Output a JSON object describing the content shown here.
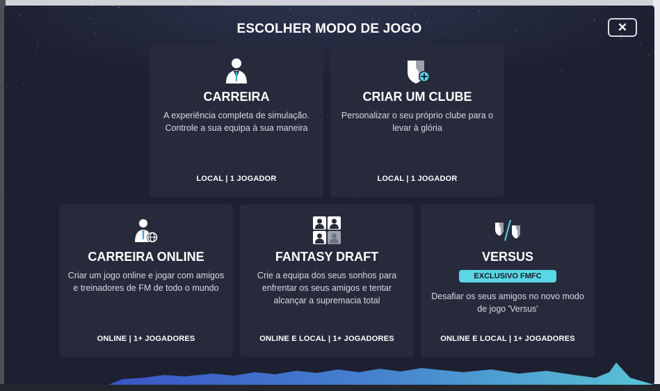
{
  "modal": {
    "title": "ESCOLHER MODO DE JOGO",
    "close_label": "✕"
  },
  "modes": [
    {
      "title": "CARREIRA",
      "description": "A experiência completa de simulação. Controle a sua equipa à sua maneira",
      "footer": "LOCAL | 1 JOGADOR",
      "icon": "manager-icon"
    },
    {
      "title": "CRIAR UM CLUBE",
      "description": "Personalizar o seu próprio clube para o levar à glória",
      "footer": "LOCAL | 1 JOGADOR",
      "icon": "create-club-icon"
    },
    {
      "title": "CARREIRA ONLINE",
      "description": "Criar um jogo online e jogar com amigos e treinadores de FM de todo o mundo",
      "footer": "ONLINE | 1+ JOGADORES",
      "icon": "online-manager-icon"
    },
    {
      "title": "FANTASY DRAFT",
      "description": "Crie a equipa dos seus sonhos para enfrentar os seus amigos e tentar alcançar a supremacia total",
      "footer": "ONLINE E LOCAL | 1+ JOGADORES",
      "icon": "fantasy-draft-icon"
    },
    {
      "title": "VERSUS",
      "badge": "EXCLUSIVO FMFC",
      "description": "Desafiar os seus amigos no novo modo de jogo 'Versus'",
      "footer": "ONLINE E LOCAL | 1+ JOGADORES",
      "icon": "versus-icon"
    }
  ],
  "colors": {
    "modal_bg": "#1d2031",
    "card_bg": "#262a3b",
    "accent": "#5ad6e4"
  }
}
